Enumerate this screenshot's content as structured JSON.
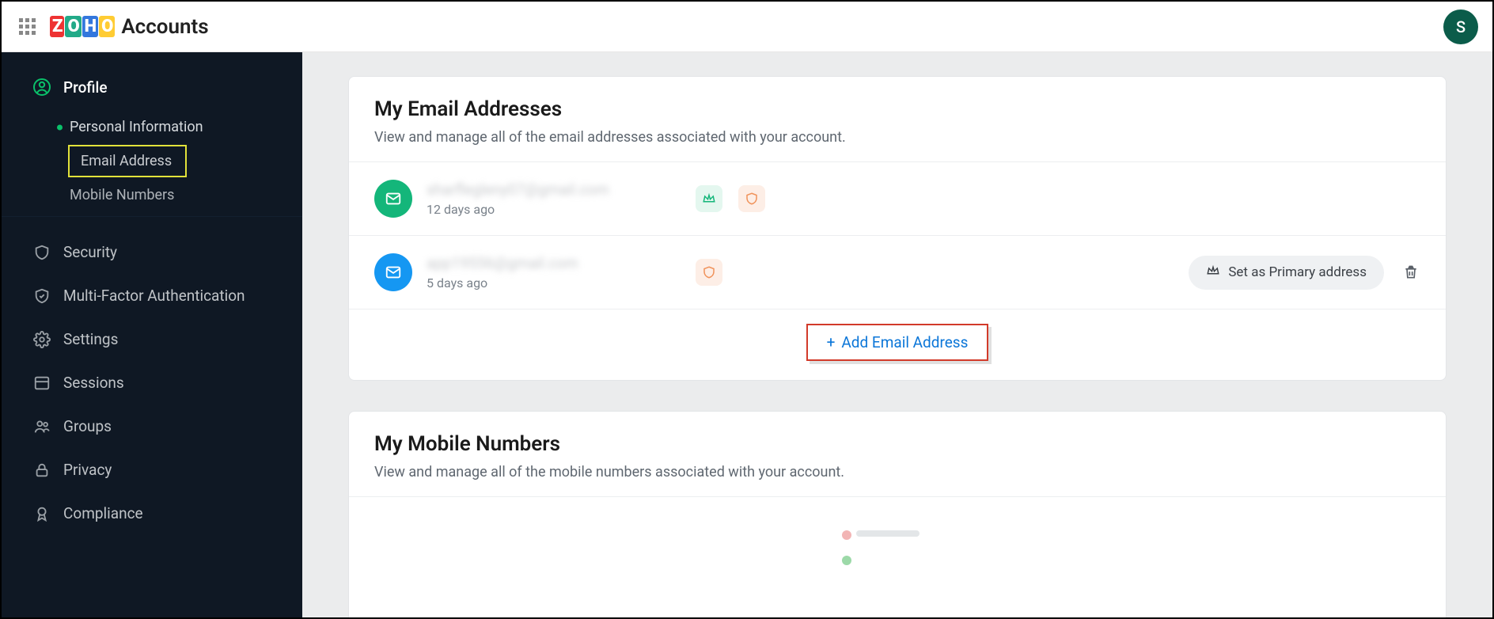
{
  "header": {
    "app_label": "Accounts",
    "avatar_letter": "S"
  },
  "sidebar": {
    "profile_label": "Profile",
    "sub": {
      "personal": "Personal Information",
      "email": "Email Address",
      "mobile": "Mobile Numbers"
    },
    "items": {
      "security": "Security",
      "mfa": "Multi-Factor Authentication",
      "settings": "Settings",
      "sessions": "Sessions",
      "groups": "Groups",
      "privacy": "Privacy",
      "compliance": "Compliance"
    }
  },
  "emails": {
    "title": "My Email Addresses",
    "subtitle": "View and manage all of the email addresses associated with your account.",
    "row1": {
      "addr": "sharflegleny07@gmail.com",
      "time": "12 days ago"
    },
    "row2": {
      "addr": "app19556@gmail.com",
      "time": "5 days ago",
      "set_primary": "Set as Primary address"
    },
    "add_label": "Add Email Address"
  },
  "mobiles": {
    "title": "My Mobile Numbers",
    "subtitle": "View and manage all of the mobile numbers associated with your account."
  }
}
